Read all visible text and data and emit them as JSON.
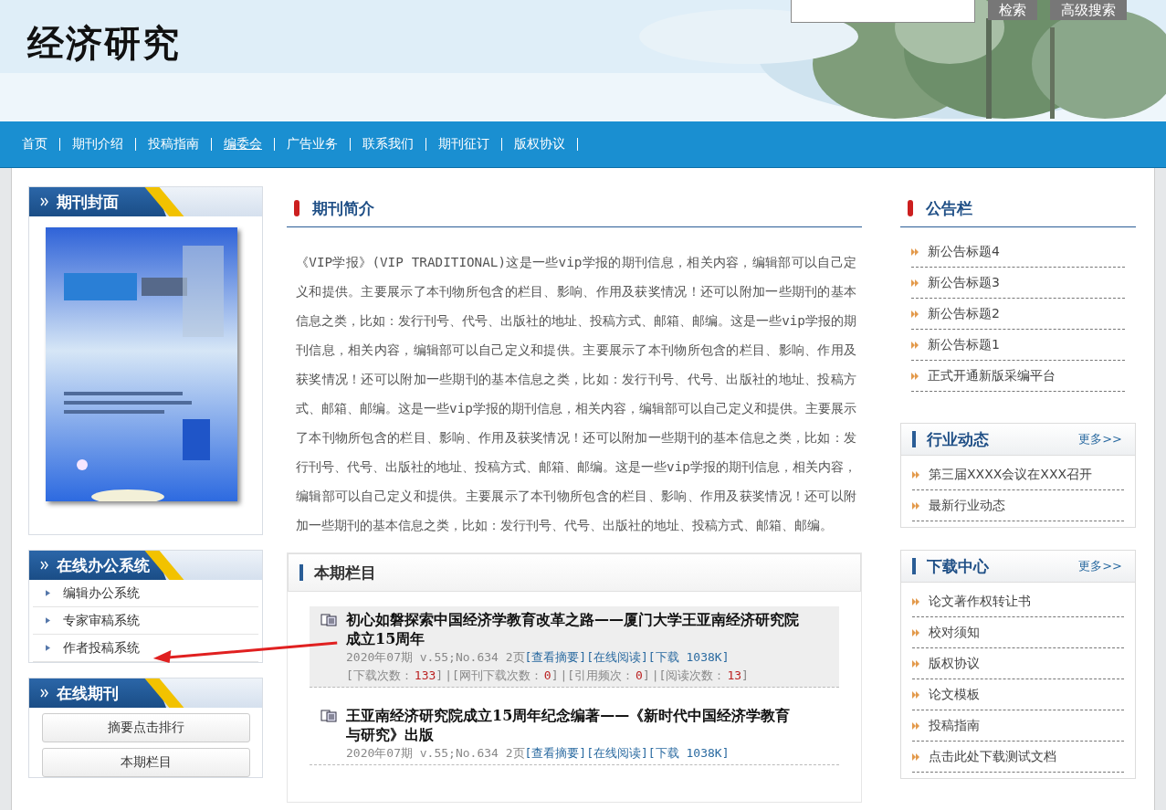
{
  "header": {
    "title": "经济研究",
    "search_buttons": [
      "检索",
      "高级搜索"
    ]
  },
  "nav": [
    {
      "label": "首页",
      "selected": false
    },
    {
      "label": "期刊介绍",
      "selected": false
    },
    {
      "label": "投稿指南",
      "selected": false
    },
    {
      "label": "编委会",
      "selected": true
    },
    {
      "label": "广告业务",
      "selected": false
    },
    {
      "label": "联系我们",
      "selected": false
    },
    {
      "label": "期刊征订",
      "selected": false
    },
    {
      "label": "版权协议",
      "selected": false
    }
  ],
  "left": {
    "cover": {
      "title": "期刊封面"
    },
    "office": {
      "title": "在线办公系统",
      "items": [
        "编辑办公系统",
        "专家审稿系统",
        "作者投稿系统"
      ]
    },
    "online": {
      "title": "在线期刊",
      "buttons": [
        "摘要点击排行",
        "本期栏目"
      ]
    }
  },
  "intro": {
    "title": "期刊简介",
    "text": "《VIP学报》(VIP TRADITIONAL)这是一些vip学报的期刊信息，相关内容，编辑部可以自己定义和提供。主要展示了本刊物所包含的栏目、影响、作用及获奖情况！还可以附加一些期刊的基本信息之类，比如：发行刊号、代号、出版社的地址、投稿方式、邮箱、邮编。这是一些vip学报的期刊信息，相关内容，编辑部可以自己定义和提供。主要展示了本刊物所包含的栏目、影响、作用及获奖情况！还可以附加一些期刊的基本信息之类，比如：发行刊号、代号、出版社的地址、投稿方式、邮箱、邮编。这是一些vip学报的期刊信息，相关内容，编辑部可以自己定义和提供。主要展示了本刊物所包含的栏目、影响、作用及获奖情况！还可以附加一些期刊的基本信息之类，比如：发行刊号、代号、出版社的地址、投稿方式、邮箱、邮编。这是一些vip学报的期刊信息，相关内容，编辑部可以自己定义和提供。主要展示了本刊物所包含的栏目、影响、作用及获奖情况！还可以附加一些期刊的基本信息之类，比如：发行刊号、代号、出版社的地址、投稿方式、邮箱、邮编。"
  },
  "issue": {
    "title": "本期栏目",
    "articles": [
      {
        "title": "初心如磐探索中国经济学教育改革之路——厦门大学王亚南经济研究院成立15周年",
        "selected": true,
        "meta": "2020年07期 v.55;No.634 2页",
        "links": [
          "[查看摘要]",
          "[在线阅读]",
          "[下载 1038K]"
        ],
        "stats": [
          {
            "label": "[下载次数：",
            "value": "133",
            "close": "]"
          },
          {
            "label": "|[网刊下载次数：",
            "value": "0",
            "close": "]"
          },
          {
            "label": "|[引用频次：",
            "value": "0",
            "close": "]"
          },
          {
            "label": "|[阅读次数：",
            "value": "13",
            "close": "]"
          }
        ]
      },
      {
        "title": "王亚南经济研究院成立15周年纪念编著——《新时代中国经济学教育与研究》出版",
        "selected": false,
        "meta": "2020年07期 v.55;No.634 2页",
        "links": [
          "[查看摘要]",
          "[在线阅读]",
          "[下载 1038K]"
        ]
      }
    ]
  },
  "right": {
    "notice": {
      "title": "公告栏",
      "items": [
        "新公告标题4",
        "新公告标题3",
        "新公告标题2",
        "新公告标题1",
        "正式开通新版采编平台"
      ]
    },
    "news": {
      "title": "行业动态",
      "more": "更多>>",
      "items": [
        "第三届XXXX会议在XXX召开",
        "最新行业动态"
      ]
    },
    "downloads": {
      "title": "下载中心",
      "more": "更多>>",
      "items": [
        "论文著作权转让书",
        "校对须知",
        "版权协议",
        "论文模板",
        "投稿指南",
        "点击此处下载测试文档"
      ]
    }
  }
}
